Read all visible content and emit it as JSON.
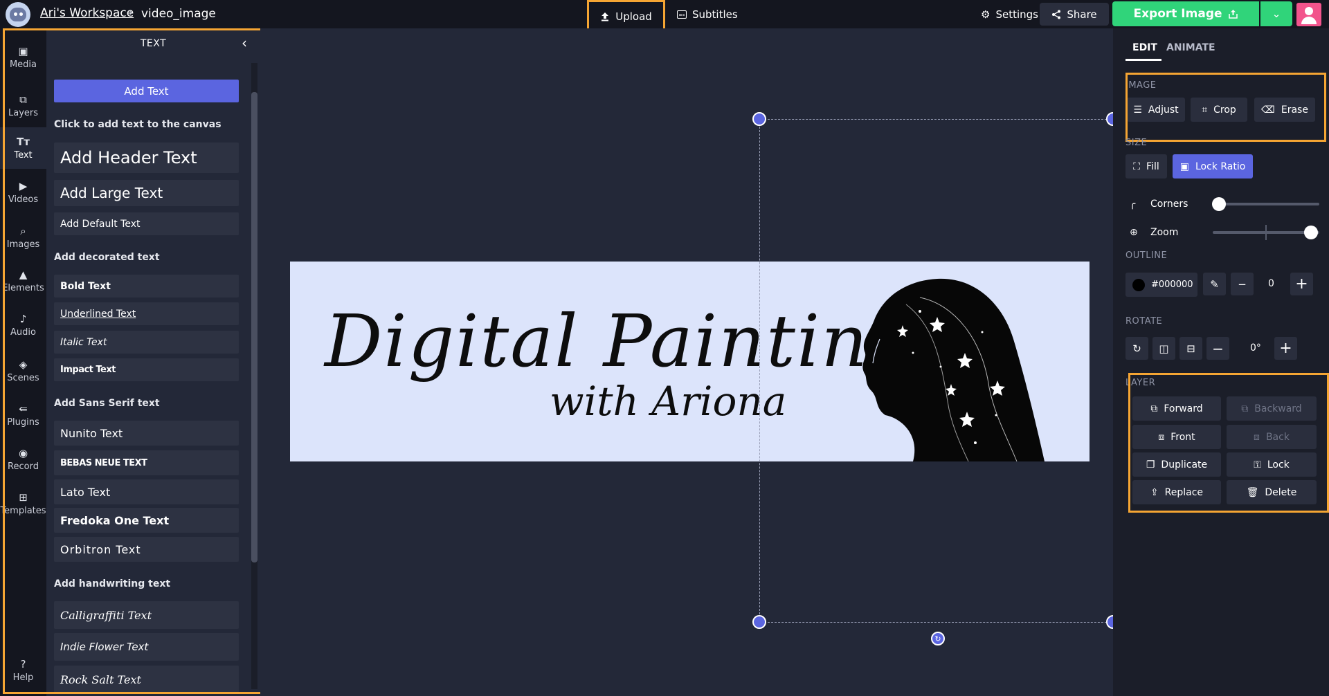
{
  "topbar": {
    "workspace": "Ari's Workspace",
    "separator": "›",
    "filename": "video_image",
    "upload": "Upload",
    "subtitles": "Subtitles",
    "settings": "Settings",
    "share": "Share",
    "export": "Export Image"
  },
  "rail": {
    "items": [
      {
        "label": "Media",
        "icon": "media-icon"
      },
      {
        "label": "Layers",
        "icon": "layers-icon"
      },
      {
        "label": "Text",
        "icon": "text-icon"
      },
      {
        "label": "Videos",
        "icon": "videos-icon"
      },
      {
        "label": "Images",
        "icon": "images-icon"
      },
      {
        "label": "Elements",
        "icon": "elements-icon"
      },
      {
        "label": "Audio",
        "icon": "audio-icon"
      },
      {
        "label": "Scenes",
        "icon": "scenes-icon"
      },
      {
        "label": "Plugins",
        "icon": "plugins-icon"
      },
      {
        "label": "Record",
        "icon": "record-icon"
      },
      {
        "label": "Templates",
        "icon": "templates-icon"
      }
    ],
    "help": "Help"
  },
  "panel": {
    "title": "TEXT",
    "add_text": "Add Text",
    "click_hint": "Click to add text to the canvas",
    "header_text": "Add Header Text",
    "large_text": "Add Large Text",
    "default_text": "Add Default Text",
    "decorated_title": "Add decorated text",
    "bold": "Bold Text",
    "underlined": "Underlined Text",
    "italic": "Italic Text",
    "impact": "Impact Text",
    "sans_title": "Add Sans Serif text",
    "nunito": "Nunito Text",
    "bebas": "BEBAS NEUE TEXT",
    "lato": "Lato Text",
    "fredoka": "Fredoka One Text",
    "orbitron": "Orbitron Text",
    "handwriting_title": "Add handwriting text",
    "calligraffiti": "Calligraffiti Text",
    "indie": "Indie Flower Text",
    "rocksalt": "Rock Salt Text"
  },
  "canvas": {
    "title": "Digital Painting",
    "subtitle": "with Ariona"
  },
  "rpanel": {
    "tab_edit": "EDIT",
    "tab_animate": "ANIMATE",
    "image_label": "IMAGE",
    "adjust": "Adjust",
    "crop": "Crop",
    "erase": "Erase",
    "size_label": "SIZE",
    "fill": "Fill",
    "lock_ratio": "Lock Ratio",
    "corners": "Corners",
    "zoom": "Zoom",
    "outline_label": "OUTLINE",
    "outline_color": "#000000",
    "outline_value": "0",
    "rotate_label": "ROTATE",
    "rotate_value": "0°",
    "layer_label": "LAYER",
    "forward": "Forward",
    "backward": "Backward",
    "front": "Front",
    "back": "Back",
    "duplicate": "Duplicate",
    "lock": "Lock",
    "replace": "Replace",
    "delete": "Delete"
  },
  "colors": {
    "accent": "#5b65e0",
    "export": "#30d47a",
    "highlight": "#f5a533"
  }
}
